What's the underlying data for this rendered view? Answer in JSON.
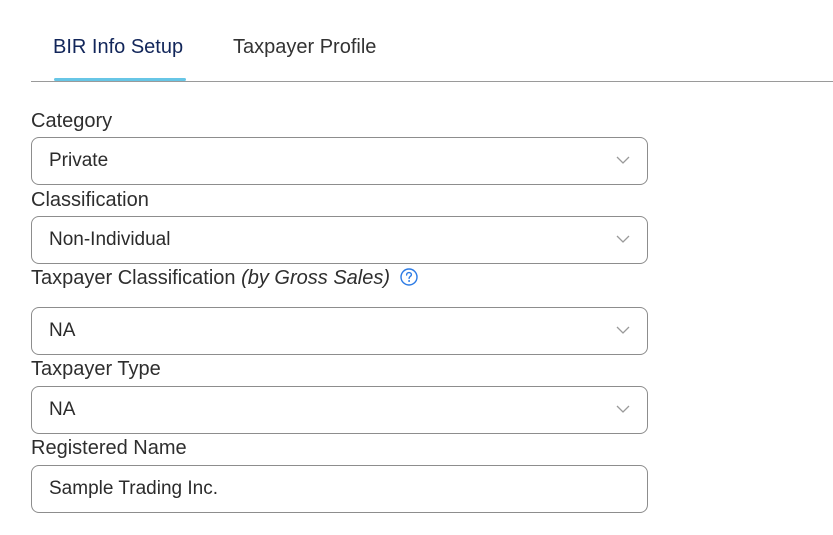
{
  "tabs": [
    {
      "label": "BIR Info Setup",
      "active": true
    },
    {
      "label": "Taxpayer Profile",
      "active": false
    }
  ],
  "accent_color": "#67c6e6",
  "form": {
    "category": {
      "label": "Category",
      "value": "Private"
    },
    "classification": {
      "label": "Classification",
      "value": "Non-Individual"
    },
    "taxpayer_classification": {
      "label": "Taxpayer Classification",
      "hint": "(by Gross Sales)",
      "value": "NA",
      "help_icon": "question-circle-icon"
    },
    "taxpayer_type": {
      "label": "Taxpayer Type",
      "value": "NA"
    },
    "registered_name": {
      "label": "Registered Name",
      "value": "Sample Trading Inc."
    }
  }
}
